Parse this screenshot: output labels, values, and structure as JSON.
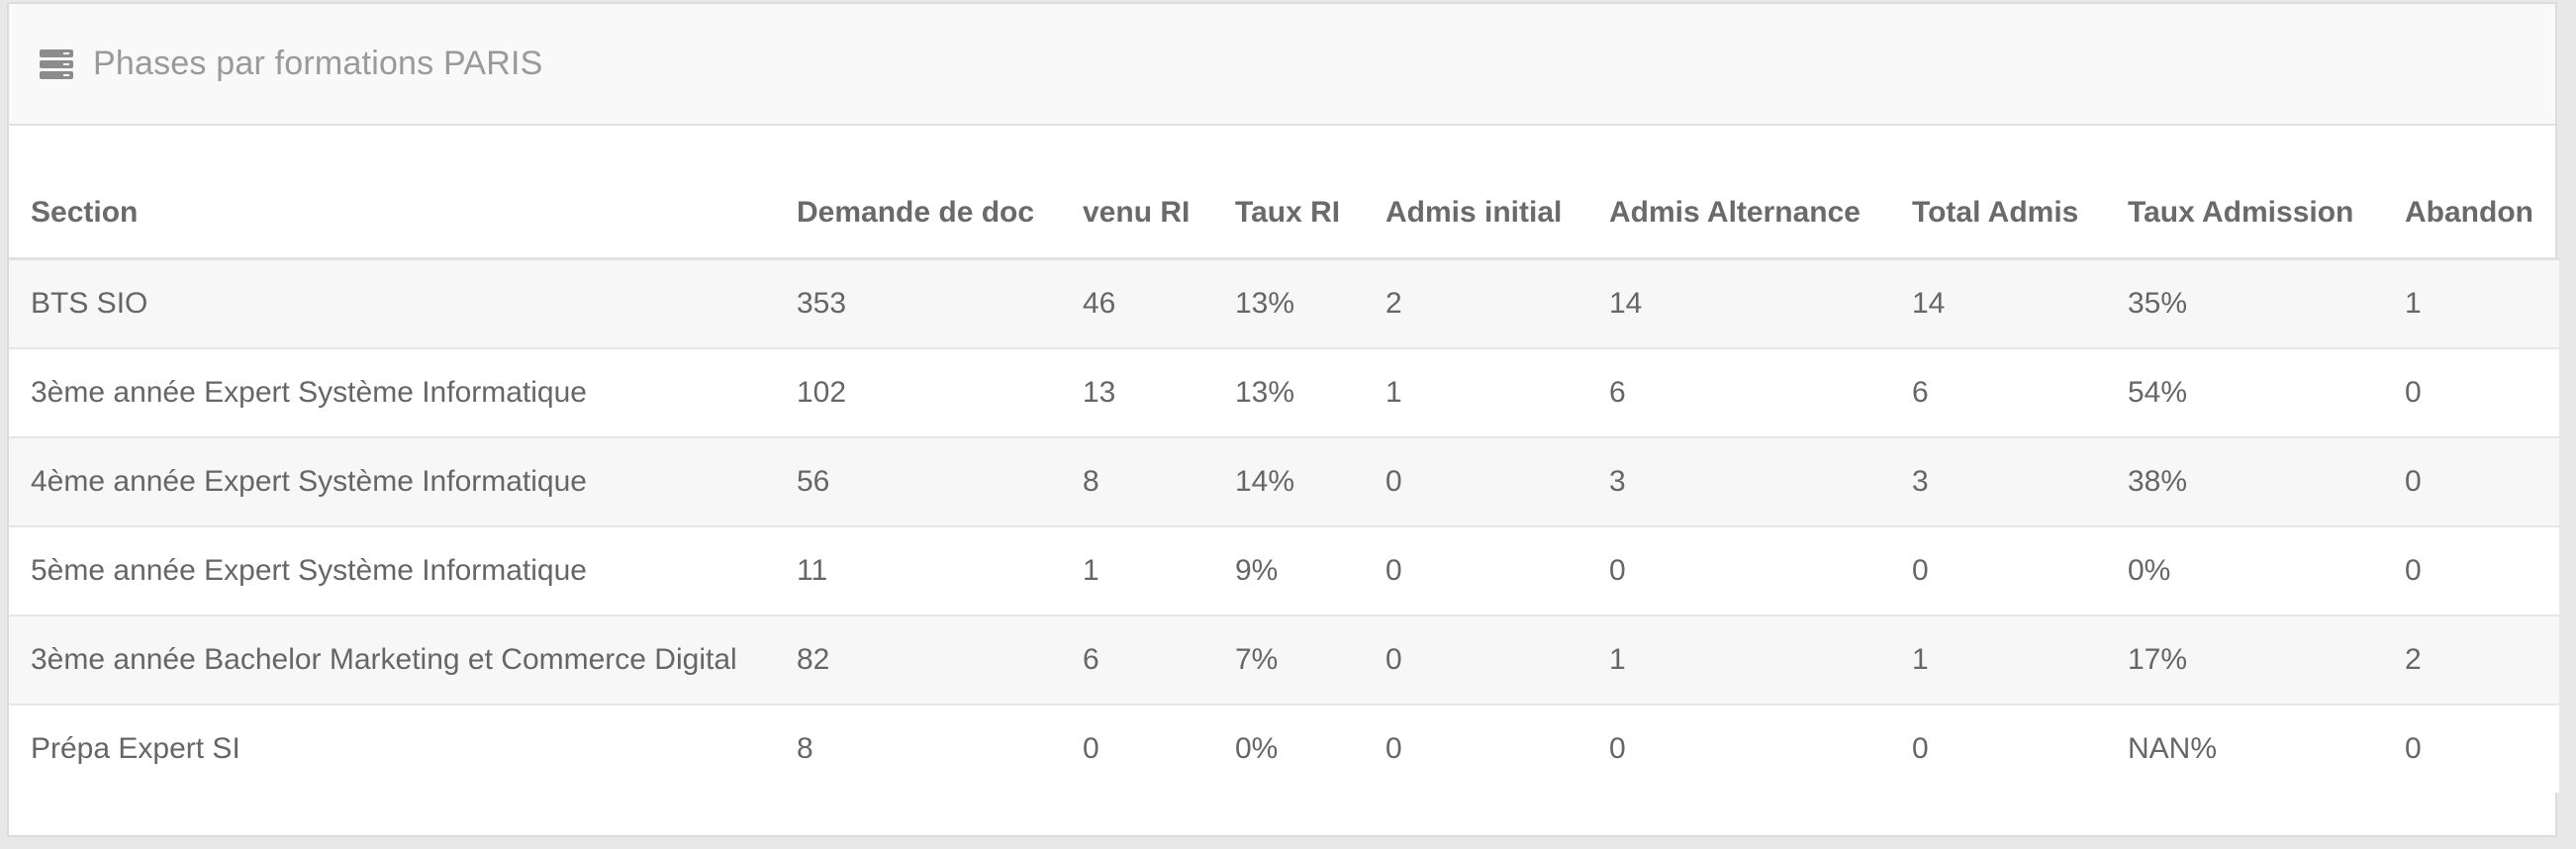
{
  "panel": {
    "title": "Phases par formations PARIS",
    "icon": "server-icon"
  },
  "table": {
    "headers": [
      "Section",
      "Demande de doc",
      "venu RI",
      "Taux RI",
      "Admis initial",
      "Admis Alternance",
      "Total Admis",
      "Taux Admission",
      "Abandon"
    ],
    "rows": [
      [
        "BTS SIO",
        "353",
        "46",
        "13%",
        "2",
        "14",
        "14",
        "35%",
        "1"
      ],
      [
        "3ème année Expert Système Informatique",
        "102",
        "13",
        "13%",
        "1",
        "6",
        "6",
        "54%",
        "0"
      ],
      [
        "4ème année Expert Système Informatique",
        "56",
        "8",
        "14%",
        "0",
        "3",
        "3",
        "38%",
        "0"
      ],
      [
        "5ème année Expert Système Informatique",
        "11",
        "1",
        "9%",
        "0",
        "0",
        "0",
        "0%",
        "0"
      ],
      [
        "3ème année Bachelor Marketing et Commerce Digital",
        "82",
        "6",
        "7%",
        "0",
        "1",
        "1",
        "17%",
        "2"
      ],
      [
        "Prépa Expert SI",
        "8",
        "0",
        "0%",
        "0",
        "0",
        "0",
        "NAN%",
        "0"
      ]
    ]
  }
}
